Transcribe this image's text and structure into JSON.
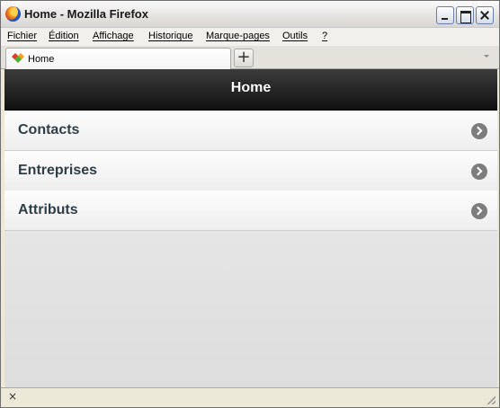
{
  "window": {
    "title": "Home - Mozilla Firefox"
  },
  "menubar": {
    "items": [
      "Fichier",
      "Édition",
      "Affichage",
      "Historique",
      "Marque-pages",
      "Outils",
      "?"
    ]
  },
  "tabs": [
    {
      "label": "Home",
      "icon": "favicon-icon"
    }
  ],
  "newtab": {
    "label": "+"
  },
  "page": {
    "header_title": "Home",
    "items": [
      {
        "label": "Contacts"
      },
      {
        "label": "Entreprises"
      },
      {
        "label": "Attributs"
      }
    ]
  },
  "statusbar": {
    "close_glyph": "×"
  },
  "colors": {
    "header_bg": "#111111",
    "item_text": "#2f3e46",
    "chevron": "#7d7d7d"
  }
}
